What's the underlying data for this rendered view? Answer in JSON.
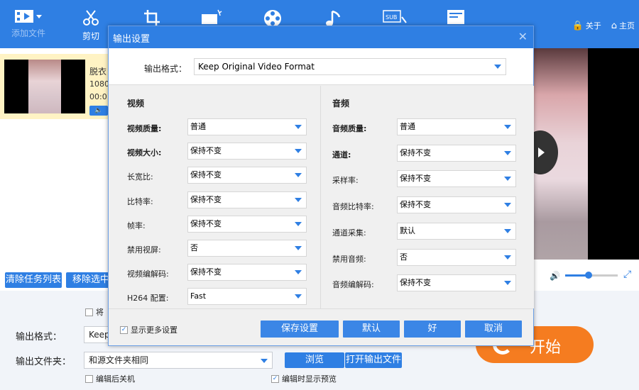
{
  "toolbar": {
    "add_file_label": "添加文件",
    "cut_label": "剪切",
    "about_label": "关于",
    "home_label": "主页"
  },
  "task": {
    "name": "脱衣",
    "resolution": "1080",
    "duration": "00:0"
  },
  "left_buttons": {
    "clear_label": "清除任务列表",
    "remove_label": "移除选中"
  },
  "bottom": {
    "merge_label": "将",
    "output_format_label": "输出格式：",
    "output_format_value": "Keep",
    "output_folder_label": "输出文件夹：",
    "output_folder_value": "和源文件夹相同",
    "browse_label": "浏览",
    "open_folder_label": "打开输出文件",
    "shutdown_label": "编辑后关机",
    "preview_label": "编辑时显示预览",
    "start_label": "开始"
  },
  "player": {
    "volume_percent": 45
  },
  "dialog": {
    "title": "输出设置",
    "format_label": "输出格式：",
    "format_value": "Keep Original Video Format",
    "video": {
      "title": "视频",
      "rows": [
        {
          "label": "视频质量:",
          "value": "普通"
        },
        {
          "label": "视频大小:",
          "value": "保持不变"
        },
        {
          "label": "长宽比:",
          "value": "保持不变"
        },
        {
          "label": "比特率:",
          "value": "保持不变"
        },
        {
          "label": "帧率:",
          "value": "保持不变"
        },
        {
          "label": "禁用视屏:",
          "value": "否"
        },
        {
          "label": "视频编解码:",
          "value": "保持不变"
        },
        {
          "label": "H264 配置:",
          "value": "Fast"
        }
      ]
    },
    "audio": {
      "title": "音频",
      "rows": [
        {
          "label": "音频质量:",
          "value": "普通"
        },
        {
          "label": "通道:",
          "value": "保持不变"
        },
        {
          "label": "采样率:",
          "value": "保持不变"
        },
        {
          "label": "音频比特率:",
          "value": "保持不变"
        },
        {
          "label": "通道采集:",
          "value": "默认"
        },
        {
          "label": "禁用音频:",
          "value": "否"
        },
        {
          "label": "音频编解码:",
          "value": "保持不变"
        }
      ]
    },
    "more_settings_label": "显示更多设置",
    "save_label": "保存设置",
    "default_label": "默认",
    "ok_label": "好",
    "cancel_label": "取消"
  },
  "colors": {
    "accent": "#2f7fe3",
    "start": "#f57c20"
  }
}
